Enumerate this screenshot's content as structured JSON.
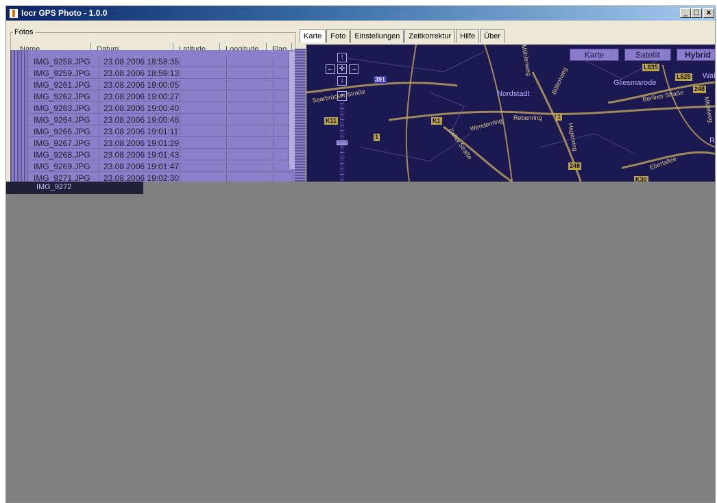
{
  "window": {
    "title": "locr GPS Photo - 1.0.0",
    "controls": {
      "minimize": "_",
      "maximize": "□",
      "close": "x"
    }
  },
  "fotos": {
    "group_label": "Fotos",
    "columns": [
      "Name",
      "Datum",
      "Latitude",
      "Longitude",
      "Flag"
    ],
    "rows": [
      {
        "name": "IMG_9258.JPG",
        "date": "23.08.2006 18:58:35"
      },
      {
        "name": "IMG_9259.JPG",
        "date": "23.08.2006 18:59:13"
      },
      {
        "name": "IMG_9261.JPG",
        "date": "23.08.2006 19:00:05"
      },
      {
        "name": "IMG_9262.JPG",
        "date": "23.08.2006 19:00:27"
      },
      {
        "name": "IMG_9263.JPG",
        "date": "23.08.2006 19:00:40"
      },
      {
        "name": "IMG_9264.JPG",
        "date": "23.08.2006 19:00:48"
      },
      {
        "name": "IMG_9266.JPG",
        "date": "23.08.2006 19:01:11"
      },
      {
        "name": "IMG_9267.JPG",
        "date": "23.08.2006 19:01:29"
      },
      {
        "name": "IMG_9268.JPG",
        "date": "23.08.2006 19:01:43"
      },
      {
        "name": "IMG_9269.JPG",
        "date": "23.08.2006 19:01:47"
      },
      {
        "name": "IMG_9271.JPG",
        "date": "23.08.2006 19:02:30"
      },
      {
        "name": "IMG_9272",
        "date": ""
      }
    ]
  },
  "tabs": [
    "Karte",
    "Foto",
    "Einstellungen",
    "Zeitkorrektur",
    "Hilfe",
    "Über"
  ],
  "map": {
    "type_buttons": {
      "karte": "Karte",
      "satellit": "Satellit",
      "hybrid": "Hybrid"
    },
    "nav": {
      "up": "↑",
      "left": "←",
      "center": "✣",
      "right": "→",
      "down": "↓",
      "zoom_in": "+"
    },
    "places": {
      "nordstadt": "Nordstadt",
      "gliesmarode": "Gliesmarode"
    },
    "road_labels": {
      "saarbruecker": "Saarbrücker Straße",
      "wendenring": "Wendenring",
      "rebenring": "Rebenring",
      "berliner": "Berliner Straße",
      "ebertallee": "Ebertallee",
      "celler": "Celler Straße",
      "hagenring": "Hagenring",
      "muehlenweg": "Mühlenweg",
      "bueltenweg": "Bültenweg",
      "mittelweg": "Mittelweg"
    },
    "shields": {
      "s391": "391",
      "k11": "K11",
      "k1": "K1",
      "s1a": "1",
      "s1b": "1",
      "s248a": "248",
      "s248b": "248",
      "l625": "L625",
      "k30": "K30",
      "l635": "L635"
    },
    "cut_labels": {
      "wabe": "Wabe",
      "r": "R"
    }
  }
}
